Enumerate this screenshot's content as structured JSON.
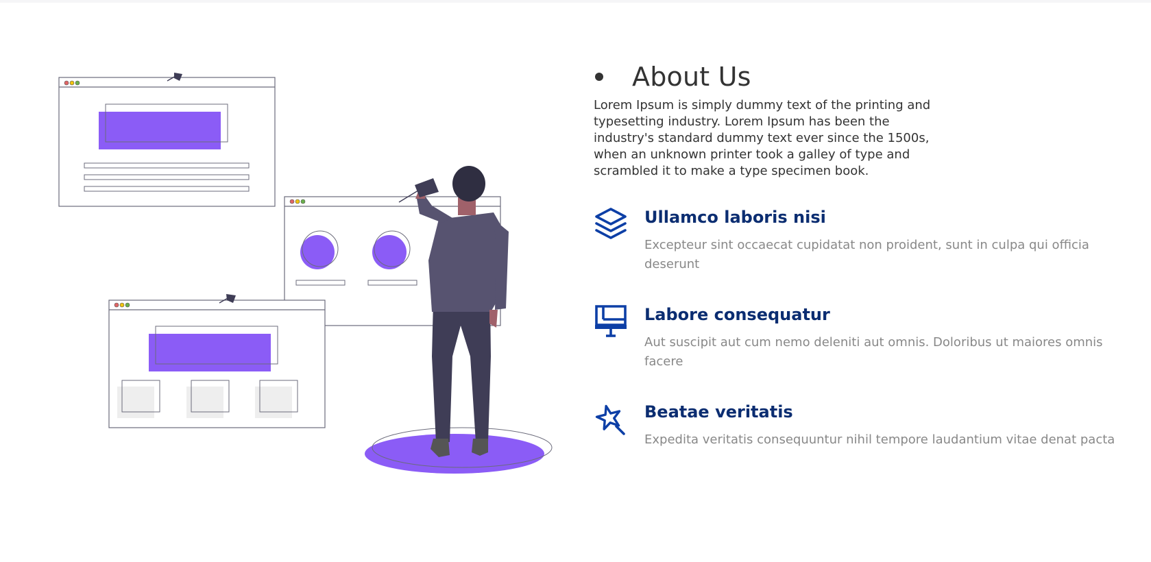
{
  "about": {
    "title": "About Us",
    "intro": "Lorem Ipsum is simply dummy text of the printing and typesetting industry. Lorem Ipsum has been the industry's standard dummy text ever since the 1500s, when an unknown printer took a galley of type and scrambled it to make a type specimen book."
  },
  "features": [
    {
      "icon": "layers-icon",
      "title": "Ullamco laboris nisi",
      "text": "Excepteur sint occaecat cupidatat non proident, sunt in culpa qui officia deserunt"
    },
    {
      "icon": "easel-icon",
      "title": "Labore consequatur",
      "text": "Aut suscipit aut cum nemo deleniti aut omnis. Doloribus ut maiores omnis facere"
    },
    {
      "icon": "magic-star-icon",
      "title": "Beatae veritatis",
      "text": "Expedita veritatis consequuntur nihil tempore laudantium vitae denat pacta"
    }
  ],
  "colors": {
    "accent_purple": "#8b5cf6",
    "heading_blue": "#0b2d71",
    "icon_blue": "#0d3fa6",
    "body_text": "#333333",
    "muted_text": "#888888"
  }
}
